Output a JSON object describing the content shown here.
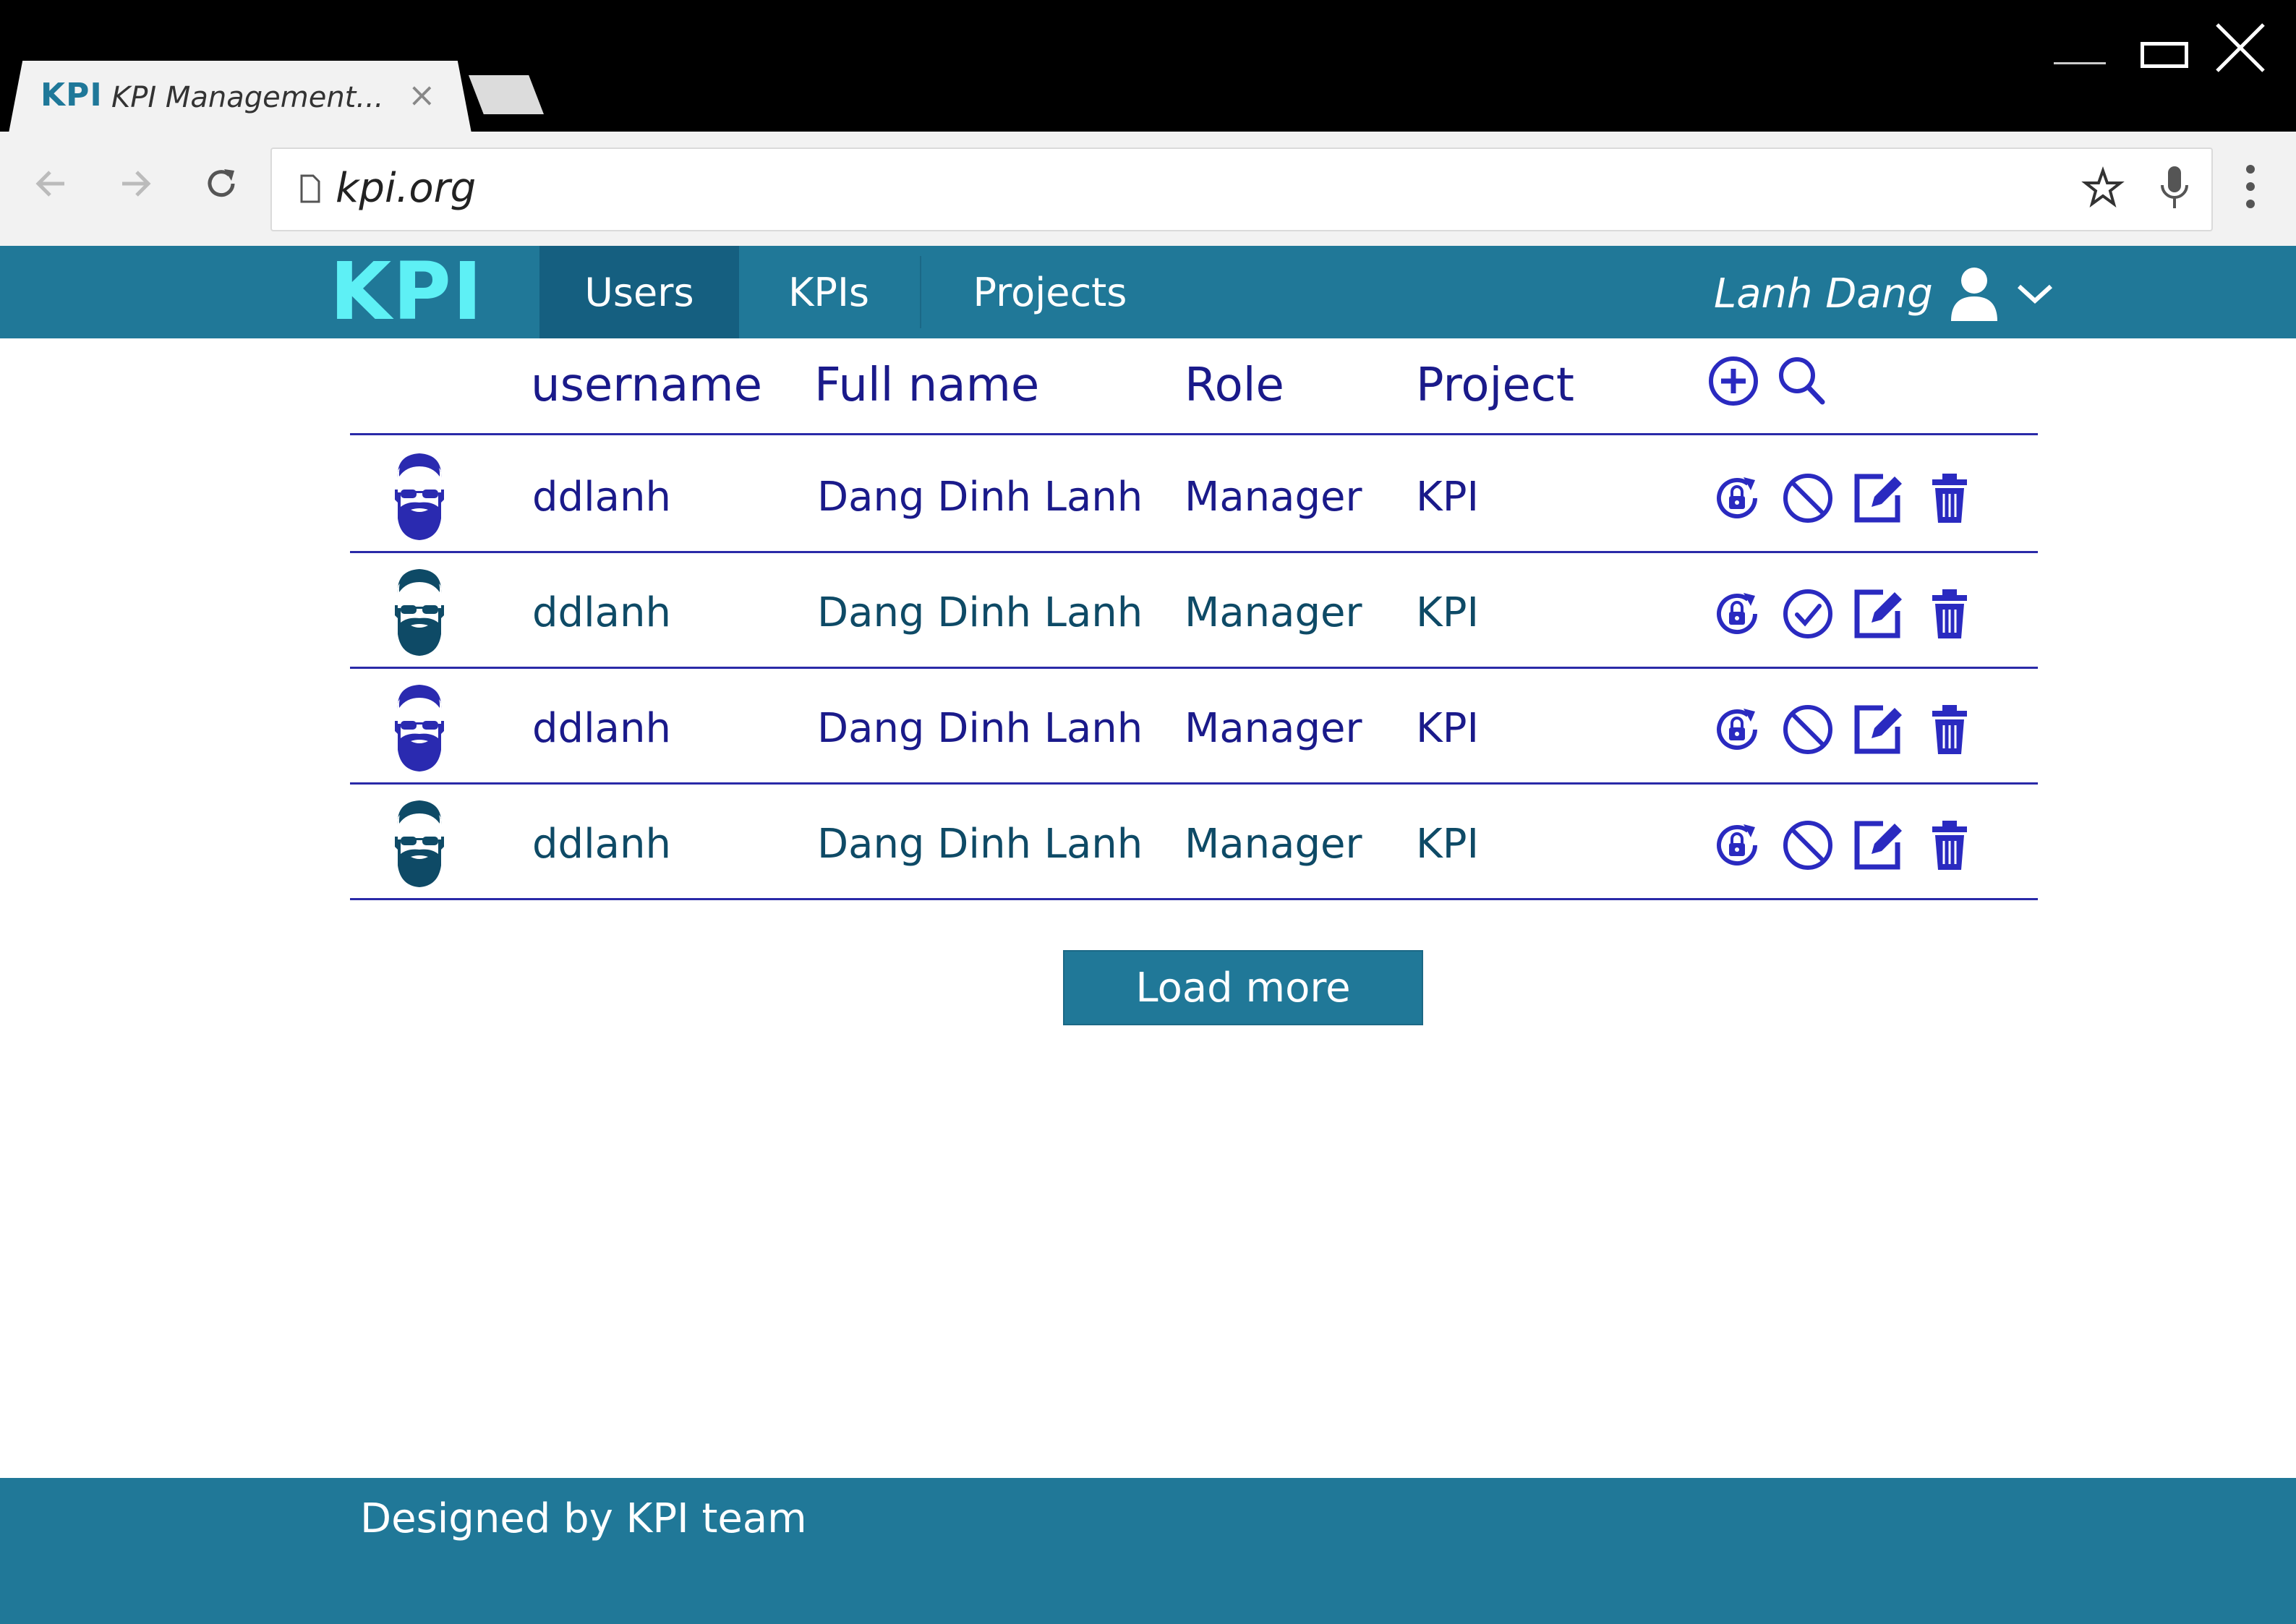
{
  "browser": {
    "tab_logo": "KPI",
    "tab_title": "KPI Management...",
    "tab_close": "×",
    "url": "kpi.org",
    "icons": [
      "back-icon",
      "forward-icon",
      "reload-icon",
      "page-icon",
      "star-icon",
      "mic-icon",
      "menu-dots-icon",
      "minimize-icon",
      "maximize-icon",
      "close-icon"
    ]
  },
  "app": {
    "logo": "KPI",
    "nav": [
      {
        "label": "Users",
        "active": true
      },
      {
        "label": "KPIs",
        "active": false
      },
      {
        "label": "Projects",
        "active": false
      }
    ],
    "user_name": "Lanh Dang",
    "colors": {
      "bar": "#207898",
      "active_tab": "#155f80",
      "logo": "#5ef0f5",
      "text_primary": "#1a1a8a",
      "text_alt": "#0e4a66",
      "icon": "#2a2ac0"
    }
  },
  "table": {
    "columns": [
      "username",
      "Full name",
      "Role",
      "Project"
    ],
    "header_actions": [
      "add-circle-icon",
      "search-icon"
    ],
    "rows": [
      {
        "username": "ddlanh",
        "full_name": "Dang Dinh Lanh",
        "role": "Manager",
        "project": "KPI",
        "status": "blocked",
        "avatar_color": "#2a2ab0",
        "text_color": "#1a1a8a"
      },
      {
        "username": "ddlanh",
        "full_name": "Dang Dinh Lanh",
        "role": "Manager",
        "project": "KPI",
        "status": "active",
        "avatar_color": "#0e4a66",
        "text_color": "#0e4a66"
      },
      {
        "username": "ddlanh",
        "full_name": "Dang Dinh Lanh",
        "role": "Manager",
        "project": "KPI",
        "status": "blocked",
        "avatar_color": "#2a2ab0",
        "text_color": "#1a1a8a"
      },
      {
        "username": "ddlanh",
        "full_name": "Dang Dinh Lanh",
        "role": "Manager",
        "project": "KPI",
        "status": "blocked",
        "avatar_color": "#0e4a66",
        "text_color": "#0e4a66"
      }
    ]
  },
  "load_more_label": "Load more",
  "footer_text": "Designed by KPI team"
}
